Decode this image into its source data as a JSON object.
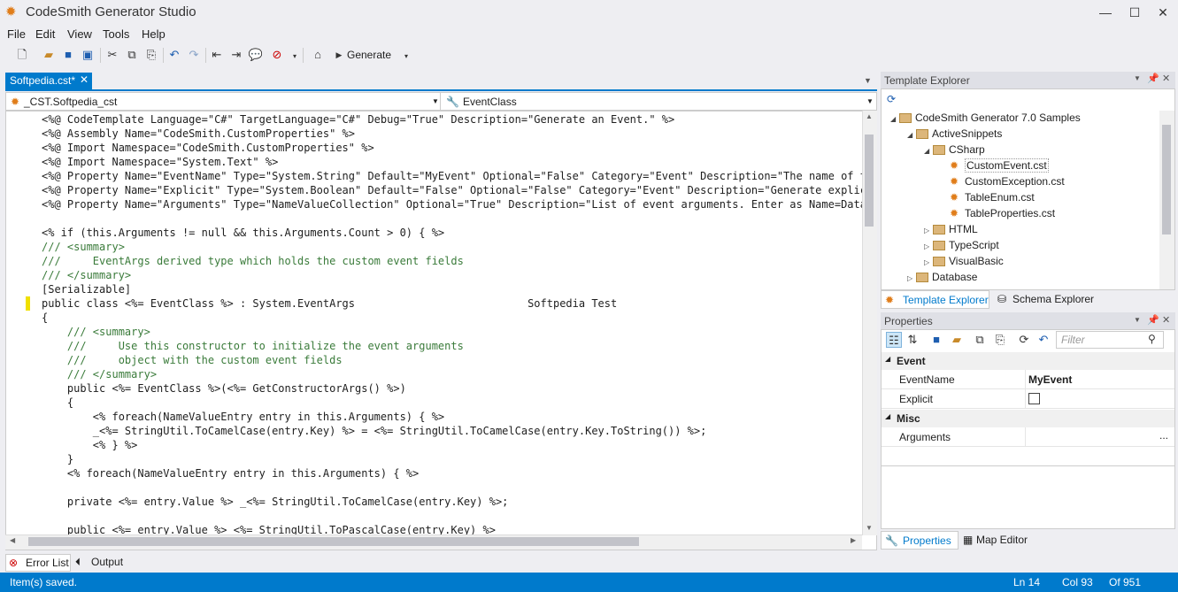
{
  "window": {
    "title": "CodeSmith Generator Studio",
    "minimize": "—",
    "maximize": "☐",
    "close": "✕"
  },
  "menu": [
    "File",
    "Edit",
    "View",
    "Tools",
    "Help"
  ],
  "toolbar": {
    "generate_label": "Generate"
  },
  "document_tab": {
    "label": "Softpedia.cst*",
    "close": "✕"
  },
  "navbar": {
    "class_selector": "_CST.Softpedia_cst",
    "member_selector": "EventClass"
  },
  "editor": {
    "lines": [
      "<%@ CodeTemplate Language=\"C#\" TargetLanguage=\"C#\" Debug=\"True\" Description=\"Generate an Event.\" %>",
      "<%@ Assembly Name=\"CodeSmith.CustomProperties\" %>",
      "<%@ Import Namespace=\"CodeSmith.CustomProperties\" %>",
      "<%@ Import Namespace=\"System.Text\" %>",
      "<%@ Property Name=\"EventName\" Type=\"System.String\" Default=\"MyEvent\" Optional=\"False\" Category=\"Event\" Description=\"The name of the e",
      "<%@ Property Name=\"Explicit\" Type=\"System.Boolean\" Default=\"False\" Optional=\"False\" Category=\"Event\" Description=\"Generate explicit i",
      "<%@ Property Name=\"Arguments\" Type=\"NameValueCollection\" Optional=\"True\" Description=\"List of event arguments. Enter as Name=DataTyp",
      "",
      "<% if (this.Arguments != null && this.Arguments.Count > 0) { %>",
      "/// <summary>",
      "///     EventArgs derived type which holds the custom event fields",
      "/// </summary>",
      "[Serializable]",
      "public class <%= EventClass %> : System.EventArgs                           Softpedia Test",
      "{",
      "    /// <summary>",
      "    ///     Use this constructor to initialize the event arguments",
      "    ///     object with the custom event fields",
      "    /// </summary>",
      "    public <%= EventClass %>(<%= GetConstructorArgs() %>)",
      "    {",
      "        <% foreach(NameValueEntry entry in this.Arguments) { %>",
      "        _<%= StringUtil.ToCamelCase(entry.Key) %> = <%= StringUtil.ToCamelCase(entry.Key.ToString()) %>;",
      "        <% } %>",
      "    }",
      "    <% foreach(NameValueEntry entry in this.Arguments) { %>",
      "",
      "    private <%= entry.Value %> _<%= StringUtil.ToCamelCase(entry.Key) %>;",
      "",
      "    public <%= entry.Value %> <%= StringUtil.ToPascalCase(entry.Key) %>"
    ]
  },
  "bottom_tabs": [
    "Error List",
    "Output"
  ],
  "status": {
    "message": "Item(s) saved.",
    "ln": "Ln 14",
    "col": "Col 93",
    "of": "Of 951"
  },
  "template_explorer": {
    "title": "Template Explorer",
    "tree": [
      {
        "label": "CodeSmith Generator 7.0 Samples",
        "kind": "folder",
        "level": 0,
        "expander": "◢"
      },
      {
        "label": "ActiveSnippets",
        "kind": "folder",
        "level": 1,
        "expander": "◢"
      },
      {
        "label": "CSharp",
        "kind": "folder",
        "level": 2,
        "expander": "◢"
      },
      {
        "label": "CustomEvent.cst",
        "kind": "file",
        "level": 3,
        "expander": ""
      },
      {
        "label": "CustomException.cst",
        "kind": "file",
        "level": 3,
        "expander": ""
      },
      {
        "label": "TableEnum.cst",
        "kind": "file",
        "level": 3,
        "expander": ""
      },
      {
        "label": "TableProperties.cst",
        "kind": "file",
        "level": 3,
        "expander": ""
      },
      {
        "label": "HTML",
        "kind": "folder",
        "level": 2,
        "expander": "▷"
      },
      {
        "label": "TypeScript",
        "kind": "folder",
        "level": 2,
        "expander": "▷"
      },
      {
        "label": "VisualBasic",
        "kind": "folder",
        "level": 2,
        "expander": "▷"
      },
      {
        "label": "Database",
        "kind": "folder",
        "level": 1,
        "expander": "▷"
      }
    ],
    "tabs": [
      "Template Explorer",
      "Schema Explorer"
    ]
  },
  "properties": {
    "title": "Properties",
    "filter_placeholder": "Filter",
    "categories": [
      {
        "name": "Event",
        "rows": [
          {
            "name": "EventName",
            "value": "MyEvent"
          },
          {
            "name": "Explicit",
            "value": ""
          }
        ]
      },
      {
        "name": "Misc",
        "rows": [
          {
            "name": "Arguments",
            "value": "..."
          }
        ]
      }
    ],
    "tabs": [
      "Properties",
      "Map Editor"
    ]
  }
}
